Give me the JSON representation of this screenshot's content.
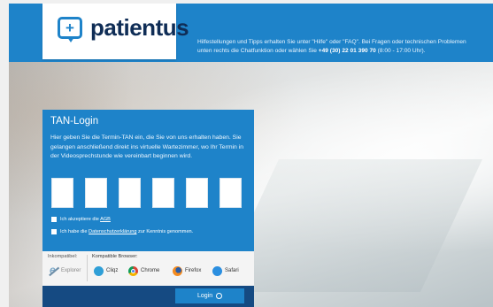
{
  "header": {
    "logo_text": "patientus",
    "help_text_line1": "Hilfestellungen und Tipps erhalten Sie unter \"Hilfe\" oder \"FAQ\". Bei Fragen oder technischen Problemen",
    "help_text_line2_prefix": "unten rechts die Chatfunktion oder wählen Sie",
    "help_phone": "+49 (30) 22 01 390 70",
    "help_hours": "(8:00 - 17:00 Uhr)."
  },
  "login": {
    "title": "TAN-Login",
    "description": "Hier geben Sie die Termin-TAN ein, die Sie von uns erhalten haben. Sie gelangen anschließend direkt ins virtuelle Wartezimmer, wo Ihr Termin in der Videosprechstunde wie vereinbart beginnen wird.",
    "tan_fields": [
      "",
      "",
      "",
      "",
      "",
      ""
    ],
    "agb_prefix": "Ich akzeptiere die",
    "agb_link": "AGB",
    "privacy_prefix": "Ich habe die",
    "privacy_link": "Datenschutzerklärung",
    "privacy_suffix": "zur Kenntnis genommen.",
    "button_label": "Login"
  },
  "browsers": {
    "incompatible_label": "Inkompatibel:",
    "compatible_label": "Kompatible Browser:",
    "incompatible": [
      "Explorer"
    ],
    "compatible": [
      "Cliqz",
      "Chrome",
      "Firefox",
      "Safari"
    ]
  },
  "colors": {
    "brand_blue": "#1e83c9",
    "dark_navy": "#154a82",
    "logo_navy": "#0f2d56"
  },
  "icons": {
    "logo": "chat-plus-icon",
    "login": "circle-check-icon"
  }
}
